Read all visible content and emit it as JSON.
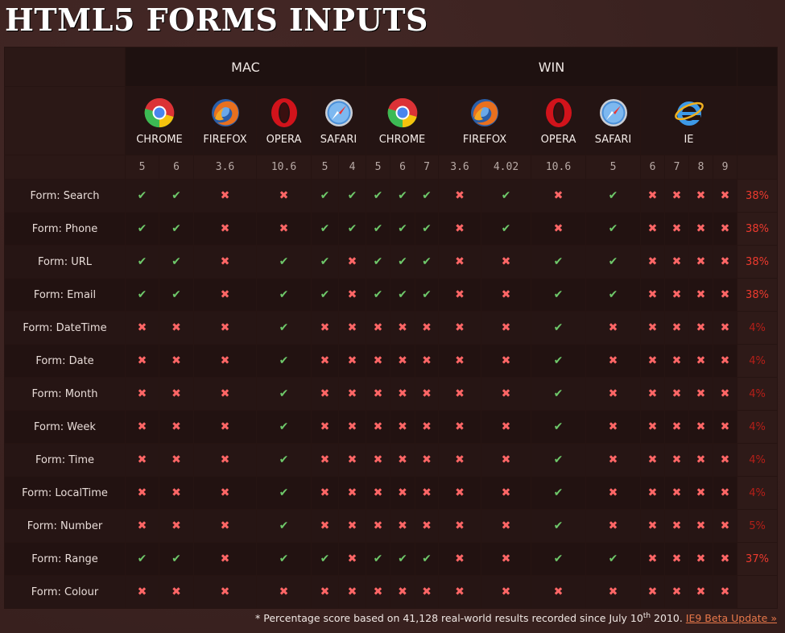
{
  "page": {
    "title": "HTML5 FORMS INPUTS",
    "footer_text": "* Percentage score based on 41,128 real-world results recorded since July 10",
    "footer_sup": "th",
    "footer_year": " 2010. ",
    "footer_link": "IE9 Beta Update »"
  },
  "groups": {
    "mac": "MAC",
    "win": "WIN"
  },
  "browsers": [
    {
      "name": "CHROME",
      "icon": "chrome-icon"
    },
    {
      "name": "FIREFOX",
      "icon": "firefox-icon"
    },
    {
      "name": "OPERA",
      "icon": "opera-icon"
    },
    {
      "name": "SAFARI",
      "icon": "safari-icon"
    },
    {
      "name": "CHROME",
      "icon": "chrome-icon"
    },
    {
      "name": "FIREFOX",
      "icon": "firefox-icon"
    },
    {
      "name": "OPERA",
      "icon": "opera-icon"
    },
    {
      "name": "SAFARI",
      "icon": "safari-icon"
    },
    {
      "name": "IE",
      "icon": "ie-icon"
    }
  ],
  "versions": [
    "5",
    "6",
    "3.6",
    "10.6",
    "5",
    "4",
    "5",
    "6",
    "7",
    "3.6",
    "4.02",
    "10.6",
    "5",
    "6",
    "7",
    "8",
    "9"
  ],
  "colors": {
    "check": "#6ec86a",
    "cross": "#ff6666",
    "pct_high": "#ee3a2e",
    "pct_low": "#b51f18",
    "background": "#3a2220"
  },
  "rows": [
    {
      "label": "Form: Search",
      "cells": "YYNNYYYYYNYNYNNNN",
      "pct": "38%"
    },
    {
      "label": "Form: Phone",
      "cells": "YYNNYYYYYNYNYNNNN",
      "pct": "38%"
    },
    {
      "label": "Form: URL",
      "cells": "YYNYYNYYYNNYYNNNN",
      "pct": "38%"
    },
    {
      "label": "Form: Email",
      "cells": "YYNYYNYYYNNYYNNNN",
      "pct": "38%"
    },
    {
      "label": "Form: DateTime",
      "cells": "NNNYNNNNNNNYNNNNN",
      "pct": "4%"
    },
    {
      "label": "Form: Date",
      "cells": "NNNYNNNNNNNYNNNNN",
      "pct": "4%"
    },
    {
      "label": "Form: Month",
      "cells": "NNNYNNNNNNNYNNNNN",
      "pct": "4%"
    },
    {
      "label": "Form: Week",
      "cells": "NNNYNNNNNNNYNNNNN",
      "pct": "4%"
    },
    {
      "label": "Form: Time",
      "cells": "NNNYNNNNNNNYNNNNN",
      "pct": "4%"
    },
    {
      "label": "Form: LocalTime",
      "cells": "NNNYNNNNNNNYNNNNN",
      "pct": "4%"
    },
    {
      "label": "Form: Number",
      "cells": "NNNYNNNNNNNYNNNNN",
      "pct": "5%"
    },
    {
      "label": "Form: Range",
      "cells": "YYNYYNYYYNNYYNNNN",
      "pct": "37%"
    },
    {
      "label": "Form: Colour",
      "cells": "NNNNNNNNNNNNNNNNN",
      "pct": ""
    }
  ]
}
